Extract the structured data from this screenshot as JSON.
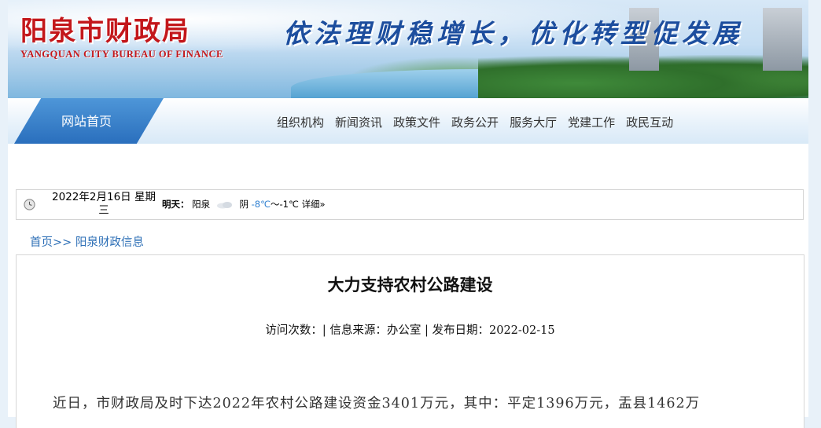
{
  "header": {
    "logo_cn": "阳泉市财政局",
    "logo_en": "YANGQUAN CITY BUREAU OF FINANCE",
    "slogan": "依法理财稳增长，优化转型促发展"
  },
  "nav": {
    "home_label": "网站首页",
    "items": [
      "组织机构",
      "新闻资讯",
      "政策文件",
      "政务公开",
      "服务大厅",
      "党建工作",
      "政民互动"
    ]
  },
  "weather": {
    "date": "2022年2月16日 星期三",
    "tomorrow_label": "明天：",
    "city": "阳泉",
    "condition": "阴",
    "temp_low": "-8℃",
    "separator": "～",
    "temp_high": "-1℃",
    "detail_link": "详细»"
  },
  "breadcrumb": {
    "home": "首页",
    "sep": ">>",
    "current": "阳泉财政信息"
  },
  "article": {
    "title": "大力支持农村公路建设",
    "meta": "访问次数：| 信息来源：办公室 |  发布日期：2022-02-15",
    "body": "近日，市财政局及时下达2022年农村公路建设资金3401万元，其中：平定1396万元，盂县1462万"
  },
  "colors": {
    "brand_red": "#c3171b",
    "slogan_blue": "#1d4e9e",
    "link_blue": "#2d6fb6",
    "nav_tab_blue": "#2a6fbd"
  }
}
